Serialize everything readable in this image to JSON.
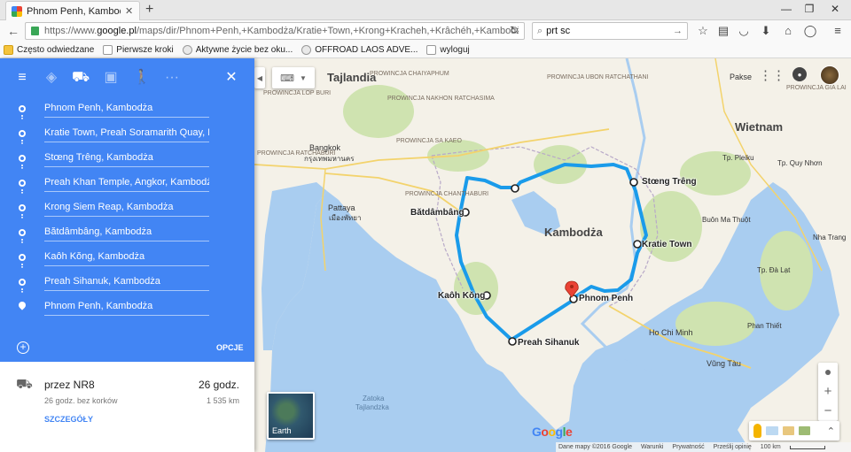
{
  "browser": {
    "tab_title": "Phnom Penh, Kambodża ...",
    "url_prefix": "https://www.",
    "url_domain": "google.pl",
    "url_rest": "/maps/dir/Phnom+Penh,+Kambodża/Kratie+Town,+Krong+Kracheh,+Krâchéh,+Kambodża/Stun",
    "search_value": "prt sc"
  },
  "bookmarks": [
    {
      "label": "Często odwiedzane",
      "icon": "folder-icon"
    },
    {
      "label": "Pierwsze kroki",
      "icon": "page-icon"
    },
    {
      "label": "Aktywne życie bez oku...",
      "icon": "leaf-icon"
    },
    {
      "label": "OFFROAD LAOS ADVE...",
      "icon": "globe-icon"
    },
    {
      "label": "wyloguj",
      "icon": "page-icon"
    }
  ],
  "directions": {
    "stops": [
      "Phnom Penh, Kambodża",
      "Kratie Town, Preah Soramarith Quay, Kr",
      "Stœng Trêng, Kambodża",
      "Preah Khan Temple, Angkor, Kambodża",
      "Krong Siem Reap, Kambodża",
      "Bătdâmbâng, Kambodża",
      "Kaôh Kŏng, Kambodża",
      "Preah Sihanuk, Kambodża",
      "Phnom Penh, Kambodża"
    ],
    "options_label": "OPCJE",
    "route": {
      "via": "przez NR8",
      "time": "26 godz.",
      "detail": "26 godz. bez korków",
      "distance": "1 535 km",
      "details_link": "SZCZEGÓŁY"
    }
  },
  "map": {
    "countries": [
      "Tajlandia",
      "Kambodża",
      "Wietnam"
    ],
    "provinces": [
      "PROWINCJA CHAIYAPHUM",
      "PROWINCJA NAKHON RATCHASIMA",
      "PROWINCJA UBON RATCHATHANI",
      "PROWINCJA LOP BURI",
      "PROWINCJA SA KAEO",
      "PROWINCJA RATCHABURI",
      "PROWINCJA CHANTHABURI",
      "PROWINCJA GIA LAI"
    ],
    "cities": [
      "Bangkok",
      "กรุงเทพมหานคร",
      "Pattaya",
      "เมืองพัทยา",
      "Pakse",
      "Ho Chi Minh",
      "Vũng Tàu",
      "Tp. Quy Nhơn",
      "Tp. Pleiku",
      "Buôn Ma Thuột",
      "Tp. Đà Lạt",
      "Phan Thiết",
      "Nha Trang"
    ],
    "waypoints": [
      "Stœng Trêng",
      "Kratie Town",
      "Bătdâmbâng",
      "Kaôh Kŏng",
      "Phnom Penh",
      "Preah Sihanuk"
    ],
    "sea": [
      "Zatoka",
      "Tajlandzka"
    ],
    "earth_label": "Earth",
    "footer": {
      "map_data": "Dane mapy ©2016 Google",
      "terms": "Warunki",
      "privacy": "Prywatność",
      "feedback": "Prześlij opinię",
      "scale": "100 km"
    },
    "route_color": "#1a9bea",
    "land_color": "#f4f1e8",
    "water_color": "#a9cdf0",
    "forest_color": "#cfe3b0"
  }
}
